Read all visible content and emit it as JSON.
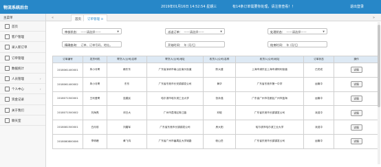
{
  "header": {
    "app_title": "物流系统后台",
    "datetime": "2019年01月16日 14:52:54 星期三",
    "notice": "有14条订单需要你处理，请注意查看！！",
    "logout_label": "退出登录"
  },
  "sidebar": {
    "heading": "主菜单",
    "items": [
      {
        "label": "首页",
        "icon": "home-icon"
      },
      {
        "label": "客户管理",
        "icon": "user-icon"
      },
      {
        "label": "录入新订单",
        "icon": "edit-icon"
      },
      {
        "label": "订单管理",
        "icon": "list-icon"
      },
      {
        "label": "数据统计",
        "icon": "chart-icon"
      },
      {
        "label": "人员管理",
        "icon": "people-icon",
        "arrow": "›"
      },
      {
        "label": "个人中心",
        "icon": "person-icon",
        "arrow": "›"
      },
      {
        "label": "资金记录",
        "icon": "money-icon"
      },
      {
        "label": "关于我们",
        "icon": "info-icon"
      },
      {
        "label": "聊天室",
        "icon": "chat-icon"
      }
    ]
  },
  "tabs": {
    "prev": "«",
    "next": "»",
    "items": [
      {
        "label": "首页"
      },
      {
        "label": "订单管理 ⊙"
      }
    ]
  },
  "filters": {
    "order_status": {
      "label": "审核状态：",
      "value": "——请选择——"
    },
    "dispatch_order": {
      "label": "派送订单：",
      "value": "——请选择——"
    },
    "process_status": {
      "label": "处理状态：",
      "value": "——请选择——"
    },
    "keyword": {
      "label": "精确查询：",
      "placeholder": "订单、订单号码、地址。"
    },
    "start_time": {
      "label": "开始时间：",
      "value": "年 /月/日"
    },
    "end_time": {
      "label": "结束时间：",
      "value": "年 /月/日"
    }
  },
  "table": {
    "columns": [
      "订单编号",
      "发货司机",
      "寄货人(公司)名称",
      "寄货人(公司)地址",
      "收货人(公司)名称",
      "收货人(公司)地址",
      "订单状态",
      "操作"
    ],
    "rows": [
      [
        "2018061400001",
        "朱小月哥",
        "赖东东",
        "广东省深圳市南山区南头街道",
        "陈大建",
        "上海市浦东区上海市浦阿利街道",
        "已完成",
        "详情"
      ],
      [
        "2018061400002",
        "朱小月哥",
        "东东",
        "广东省东莞市长安镇镇发公司",
        "黄华",
        "广东省东莞市第一中学",
        "运输中",
        "详情"
      ],
      [
        "2018071500001",
        "王利爱哥",
        "连建民",
        "哈尔滨市哈尔滨工业大学",
        "张永强",
        "广东省广州市花都区广州市蓝海",
        "运输中",
        "详情"
      ],
      [
        "2018071500002",
        "刘海亮",
        "邓日大",
        "广州市荔湾区珠江路",
        "邓毅",
        "广东省东莞市长镇镇发公司",
        "派送中",
        "详情"
      ],
      [
        "2018081500001",
        "白月前",
        "刘磨军",
        "广东省东莞市长镇镇发公司",
        "房大阳",
        "哈尔滨市哈尔滨工业大学",
        "派送中",
        "详情"
      ],
      [
        "2018080800006",
        "李明峰",
        "黄飞鸿",
        "广东省广州市番禺区大学城路",
        "帐山岳",
        "广东省东莞市长镇镇发公司",
        "运输中",
        "详情"
      ]
    ]
  }
}
